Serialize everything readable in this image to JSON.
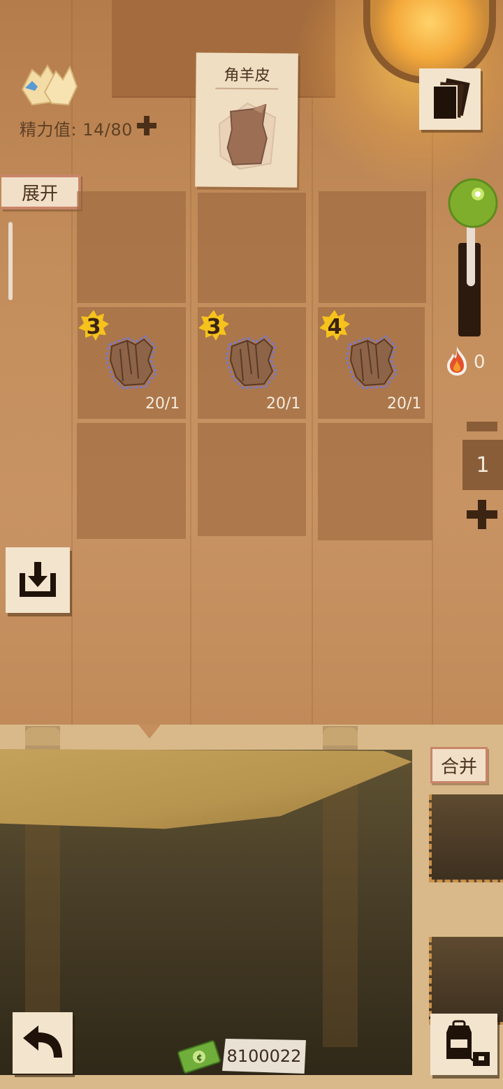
{
  "hud": {
    "energy_label": "精力值: 14/80"
  },
  "sidebar": {
    "expand_label": "展开"
  },
  "item_card": {
    "title": "角羊皮"
  },
  "grid": {
    "slots": [
      {
        "level": "3",
        "count": "20/1"
      },
      {
        "level": "3",
        "count": "20/1"
      },
      {
        "level": "4",
        "count": "20/1"
      }
    ]
  },
  "right_panel": {
    "fire_value": "0",
    "tab_value": "1"
  },
  "bottom": {
    "merge_label": "合并",
    "money_value": "8100022"
  },
  "colors": {
    "accent_badge": "#f6c21c",
    "panel_paper": "#f3e4cd",
    "orb_green": "#7fae2c"
  }
}
